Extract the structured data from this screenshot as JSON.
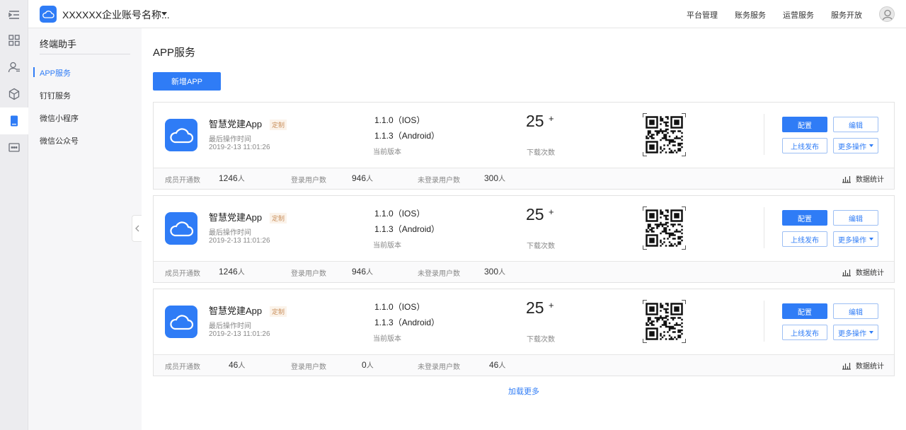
{
  "header": {
    "org_name": "XXXXXX企业账号名称...",
    "nav": [
      "平台管理",
      "账务服务",
      "运营服务",
      "服务开放"
    ]
  },
  "sidebar": {
    "title": "终端助手",
    "items": [
      {
        "label": "APP服务",
        "active": true
      },
      {
        "label": "钉钉服务",
        "active": false
      },
      {
        "label": "微信小程序",
        "active": false
      },
      {
        "label": "微信公众号",
        "active": false
      }
    ]
  },
  "main": {
    "title": "APP服务",
    "new_button": "新增APP",
    "labels": {
      "custom_tag": "定制",
      "last_op": "最后操作时间",
      "current_version": "当前版本",
      "downloads": "下载次数",
      "plus": "+",
      "configure": "配置",
      "edit": "编辑",
      "publish": "上线发布",
      "more": "更多操作",
      "members_opened": "成员开通数",
      "logged_in": "登录用户数",
      "not_logged_in": "未登录用户数",
      "unit": "人",
      "stats": "数据统计"
    },
    "apps": [
      {
        "name": "智慧党建App",
        "time": "2019-2-13 11:01:26",
        "ios": "1.1.0（IOS）",
        "android": "1.1.3（Android）",
        "downloads": "25",
        "members": "1246",
        "logged": "946",
        "not_logged": "300"
      },
      {
        "name": "智慧党建App",
        "time": "2019-2-13 11:01:26",
        "ios": "1.1.0（IOS）",
        "android": "1.1.3（Android）",
        "downloads": "25",
        "members": "1246",
        "logged": "946",
        "not_logged": "300"
      },
      {
        "name": "智慧党建App",
        "time": "2019-2-13 11:01:26",
        "ios": "1.1.0（IOS）",
        "android": "1.1.3（Android）",
        "downloads": "25",
        "members": "46",
        "logged": "0",
        "not_logged": "46"
      }
    ],
    "load_more": "加载更多"
  },
  "colors": {
    "accent": "#2f7cf6",
    "tag": "#c98f5c"
  }
}
